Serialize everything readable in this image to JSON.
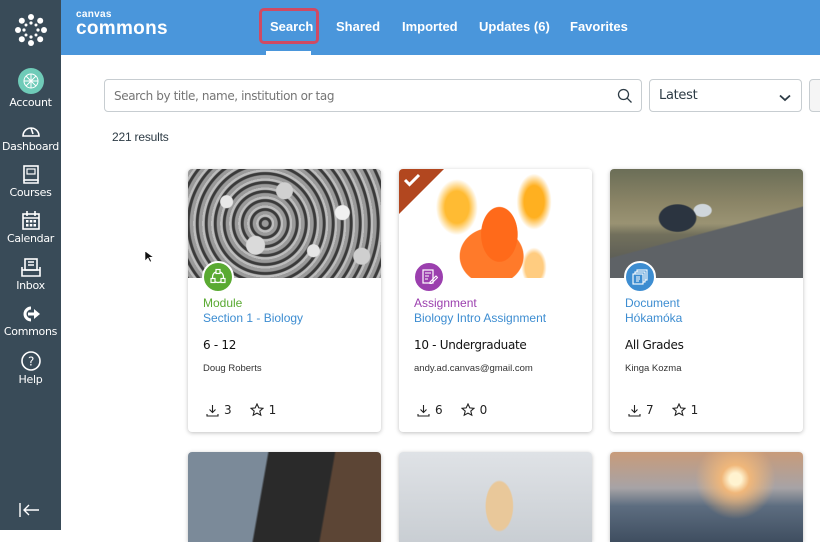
{
  "app": {
    "brand_small": "canvas",
    "brand_big": "commons"
  },
  "global_nav": {
    "items": [
      {
        "label": "Account",
        "icon": "account-avatar-icon"
      },
      {
        "label": "Dashboard",
        "icon": "dashboard-gauge-icon"
      },
      {
        "label": "Courses",
        "icon": "courses-book-icon"
      },
      {
        "label": "Calendar",
        "icon": "calendar-icon"
      },
      {
        "label": "Inbox",
        "icon": "inbox-icon"
      },
      {
        "label": "Commons",
        "icon": "commons-arrow-icon"
      },
      {
        "label": "Help",
        "icon": "help-question-icon"
      }
    ],
    "collapse_icon": "collapse-nav-icon"
  },
  "tabs": [
    {
      "label": "Search",
      "active": true
    },
    {
      "label": "Shared",
      "active": false
    },
    {
      "label": "Imported",
      "active": false
    },
    {
      "label": "Updates (6)",
      "active": false
    },
    {
      "label": "Favorites",
      "active": false
    }
  ],
  "search": {
    "placeholder": "Search by title, name, institution or tag",
    "value": ""
  },
  "sort": {
    "selected": "Latest"
  },
  "results_count": "221 results",
  "colors": {
    "nav_bg": "#394b58",
    "topbar_bg": "#4a96db",
    "active_tab_highlight": "#d04a63",
    "module_green": "#5aaa32",
    "assignment_purple": "#9b3fae",
    "document_blue": "#3d8dd1",
    "imported_ribbon": "#b2471f"
  },
  "cards": [
    {
      "type": "Module",
      "title": "Section 1 - Biology",
      "grade": "6 - 12",
      "author": "Doug Roberts",
      "downloads": "3",
      "favorites": "1",
      "imported": false,
      "image": "coral-microscope-image"
    },
    {
      "type": "Assignment",
      "title": "Biology Intro Assignment",
      "grade": "10 - Undergraduate",
      "author": "andy.ad.canvas@gmail.com",
      "downloads": "6",
      "favorites": "0",
      "imported": true,
      "image": "goldfish-image"
    },
    {
      "type": "Document",
      "title": "Hókamóka",
      "grade": "All Grades",
      "author": "Kinga Kozma",
      "downloads": "7",
      "favorites": "1",
      "imported": false,
      "image": "motorcycle-image"
    }
  ],
  "cards_row2": [
    {
      "image": "writing-notes-image"
    },
    {
      "image": "anatomy-model-image"
    },
    {
      "image": "city-sunset-image"
    }
  ]
}
